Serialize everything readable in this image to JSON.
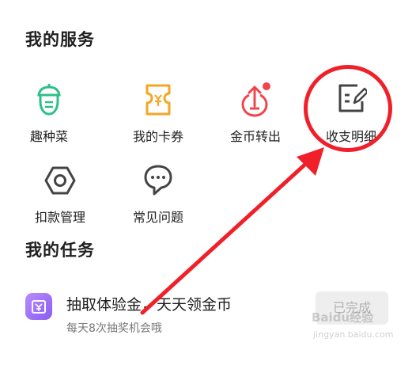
{
  "services": {
    "title": "我的服务",
    "items": [
      {
        "label": "趣种菜",
        "icon": "acorn-icon"
      },
      {
        "label": "我的卡券",
        "icon": "coupon-icon"
      },
      {
        "label": "金币转出",
        "icon": "coin-transfer-icon"
      },
      {
        "label": "收支明细",
        "icon": "edit-document-icon"
      },
      {
        "label": "扣款管理",
        "icon": "hexagon-nut-icon"
      },
      {
        "label": "常见问题",
        "icon": "chat-bubble-icon"
      }
    ]
  },
  "tasks": {
    "title": "我的任务",
    "items": [
      {
        "title": "抽取体验金，天天领金币",
        "subtitle": "每天8次抽奖机会哦",
        "button": "已完成",
        "icon": "lottery-icon"
      }
    ]
  },
  "watermark": {
    "text": "Baidu经验",
    "sub": "jingyan.baidu.com"
  },
  "colors": {
    "green": "#2fbf8a",
    "orange": "#f5a623",
    "red": "#f0454b",
    "dark_icon": "#444444",
    "annotation": "#f0202a",
    "task_icon": "#9b6cf7"
  }
}
